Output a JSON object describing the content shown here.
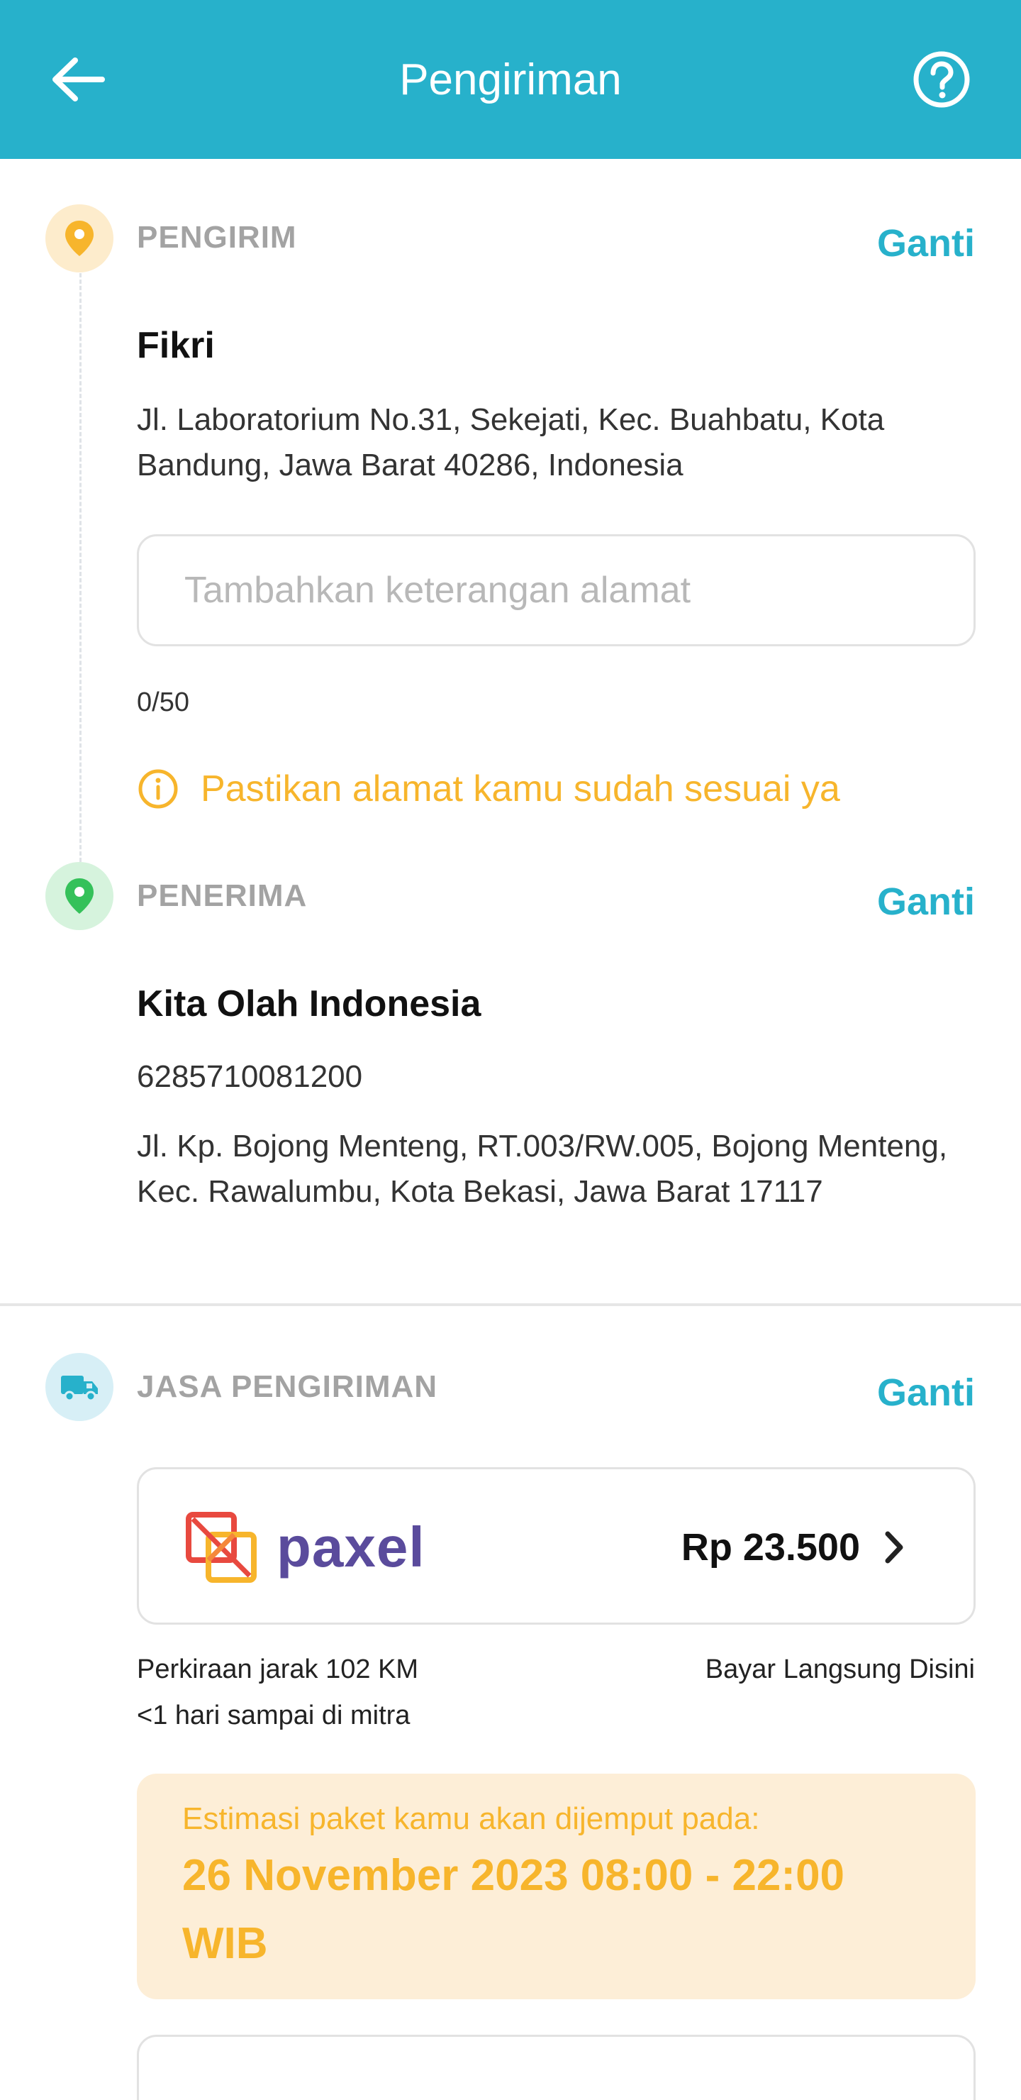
{
  "header": {
    "title": "Pengiriman",
    "back_icon": "arrow-left-icon",
    "help_icon": "question-circle-icon",
    "background": "#27b1cb"
  },
  "sender": {
    "section_label": "PENGIRIM",
    "change_label": "Ganti",
    "name": "Fikri",
    "address": "Jl. Laboratorium No.31, Sekejati, Kec. Buahbatu, Kota Bandung, Jawa Barat 40286, Indonesia",
    "note_placeholder": "Tambahkan keterangan alamat",
    "note_value": "",
    "char_counter": "0/50",
    "warning_text": "Pastikan alamat kamu sudah sesuai ya",
    "pin_color": "#f7b52c"
  },
  "receiver": {
    "section_label": "PENERIMA",
    "change_label": "Ganti",
    "name": "Kita Olah Indonesia",
    "phone": "6285710081200",
    "address": "Jl. Kp. Bojong Menteng, RT.003/RW.005, Bojong Menteng, Kec. Rawalumbu, Kota Bekasi, Jawa Barat 17117",
    "pin_color": "#35c15a"
  },
  "shipping": {
    "section_label": "JASA PENGIRIMAN",
    "change_label": "Ganti",
    "courier_name": "paxel",
    "price": "Rp 23.500",
    "distance": "Perkiraan jarak 102 KM",
    "payment": "Bayar Langsung Disini",
    "duration": "<1 hari sampai di mitra",
    "estimate_label": "Estimasi paket kamu akan dijemput pada:",
    "estimate_datetime": "26 November 2023 08:00 - 22:00 WIB"
  },
  "colors": {
    "accent": "#27b1cb",
    "warning": "#f7b52c",
    "estimate_bg": "#fdeed7"
  }
}
